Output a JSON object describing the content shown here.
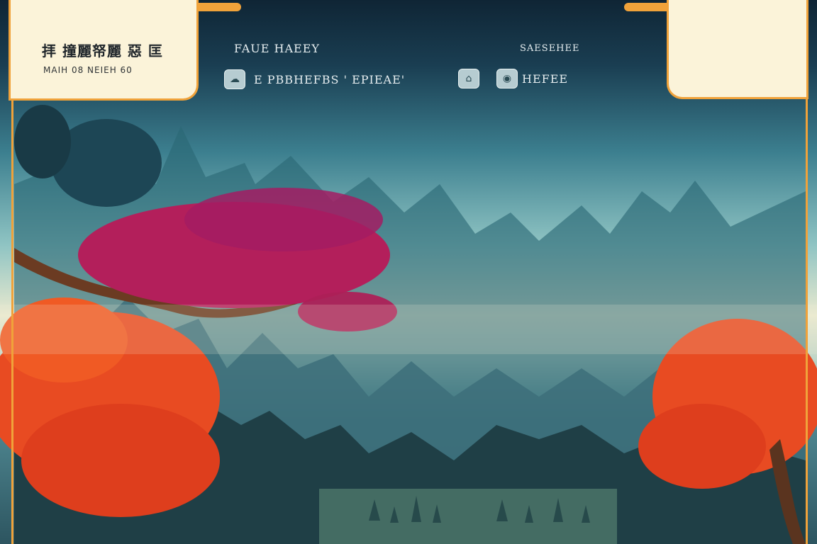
{
  "header": {
    "panel_left": {
      "title": "拝 撞麗帑麗 惡 匡",
      "subtitle": "MAIH 08 NEIEH 60"
    },
    "top_left_text": "FAUE HAEEY",
    "top_right_text": "SAESEHEE",
    "menu": {
      "item_1": "E PBBHEFBS ' EPIEAE'",
      "item_2": "HEFEE"
    }
  },
  "colors": {
    "accent": "#f0a23a",
    "panel_bg": "#fbf3d9",
    "sky_top": "#0f2535",
    "mist": "#e9e9cf",
    "mountain": "#2d5560",
    "tree_red": "#e84b22",
    "tree_magenta": "#b31f5b"
  },
  "icons": [
    "cloud-icon",
    "map-icon",
    "globe-icon"
  ]
}
